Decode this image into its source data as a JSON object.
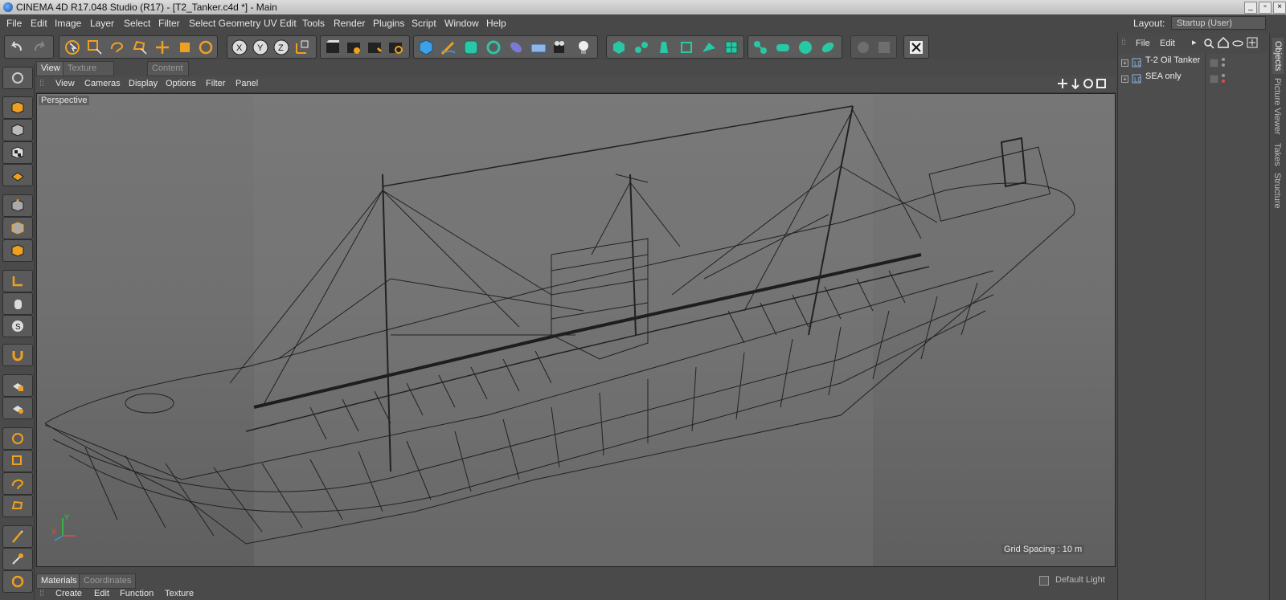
{
  "window": {
    "title": "CINEMA 4D R17.048 Studio (R17) - [T2_Tanker.c4d *] - Main"
  },
  "menu": [
    "File",
    "Edit",
    "Image",
    "Layer",
    "Select",
    "Filter",
    "Select Geometry",
    "UV Edit",
    "Tools",
    "Render",
    "Plugins",
    "Script",
    "Window",
    "Help"
  ],
  "layout": {
    "label": "Layout:",
    "value": "Startup (User)"
  },
  "view_tabs": [
    "View",
    "Texture Manager...",
    "Content Browser"
  ],
  "view_menu": [
    "View",
    "Cameras",
    "Display",
    "Options",
    "Filter",
    "Panel"
  ],
  "viewport": {
    "label": "Perspective",
    "grid_spacing": "Grid Spacing : 10 m"
  },
  "bottom_tabs": [
    "Materials",
    "Coordinates"
  ],
  "material_menu": [
    "Create",
    "Edit",
    "Function",
    "Texture"
  ],
  "default_light": "Default Light",
  "objects_panel": {
    "menu": [
      "File",
      "Edit"
    ],
    "items": [
      {
        "name": "T-2 Oil Tanker"
      },
      {
        "name": "SEA only"
      }
    ]
  },
  "side_tabs": [
    "Objects",
    "Picture Viewer",
    "Takes",
    "Structure"
  ],
  "colors": {
    "accent": "#f0a020",
    "teal": "#29c7a3",
    "blue": "#3da0e8"
  }
}
